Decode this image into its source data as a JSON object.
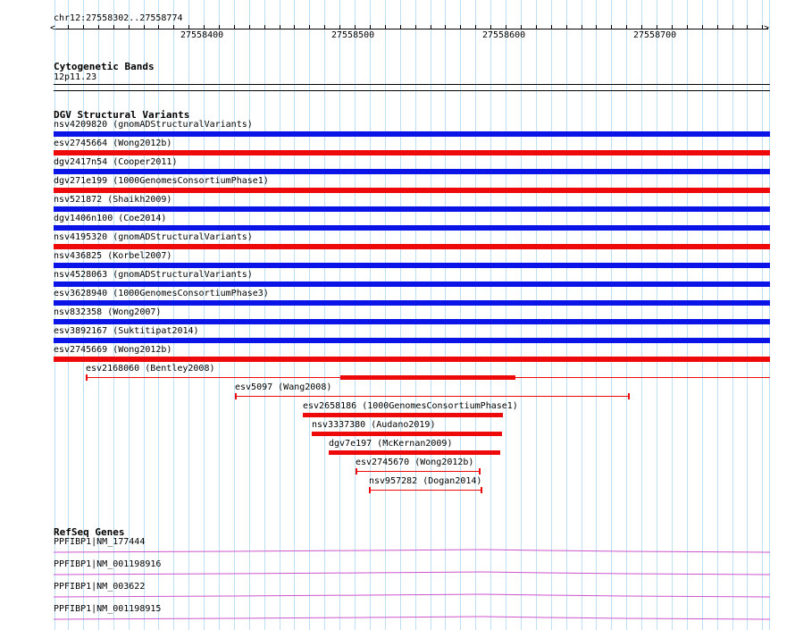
{
  "ruler": {
    "location": "chr12:27558302..27558774",
    "ticks": [
      "27558400",
      "27558500",
      "27558600",
      "27558700"
    ]
  },
  "cytoband": {
    "title": "Cytogenetic Bands",
    "band": "12p11.23"
  },
  "dgv": {
    "title": "DGV Structural Variants",
    "full_rows": [
      {
        "label": "nsv4209820 (gnomADStructuralVariants)",
        "color": "blue"
      },
      {
        "label": "esv2745664 (Wong2012b)",
        "color": "red"
      },
      {
        "label": "dgv2417n54 (Cooper2011)",
        "color": "blue"
      },
      {
        "label": "dgv271e199 (1000GenomesConsortiumPhase1)",
        "color": "red"
      },
      {
        "label": "nsv521872 (Shaikh2009)",
        "color": "blue"
      },
      {
        "label": "dgv1406n100 (Coe2014)",
        "color": "blue"
      },
      {
        "label": "nsv4195320 (gnomADStructuralVariants)",
        "color": "red"
      },
      {
        "label": "nsv436825 (Korbel2007)",
        "color": "blue"
      },
      {
        "label": "nsv4528063 (gnomADStructuralVariants)",
        "color": "blue"
      },
      {
        "label": "esv3628940 (1000GenomesConsortiumPhase3)",
        "color": "blue"
      },
      {
        "label": "nsv832358 (Wong2007)",
        "color": "blue"
      },
      {
        "label": "esv3892167 (Suktitipat2014)",
        "color": "blue"
      },
      {
        "label": "esv2745669 (Wong2012b)",
        "color": "red"
      }
    ],
    "partial_rows": [
      {
        "label": "esv2168060 (Bentley2008)"
      },
      {
        "label": "esv5097 (Wang2008)"
      },
      {
        "label": "esv2658186 (1000GenomesConsortiumPhase1)"
      },
      {
        "label": "nsv3337380 (Audano2019)"
      },
      {
        "label": "dgv7e197 (McKernan2009)"
      },
      {
        "label": "esv2745670 (Wong2012b)"
      },
      {
        "label": "nsv957282 (Dogan2014)"
      }
    ]
  },
  "refseq": {
    "title": "RefSeq Genes",
    "genes": [
      {
        "label": "PPFIBP1|NM_177444"
      },
      {
        "label": "PPFIBP1|NM_001198916"
      },
      {
        "label": "PPFIBP1|NM_003622"
      },
      {
        "label": "PPFIBP1|NM_001198915"
      }
    ]
  },
  "colors": {
    "blue": "#0a14e6",
    "red": "#ee0a0a",
    "grid": "#bfe0f2",
    "gene": "#cc55cc"
  }
}
